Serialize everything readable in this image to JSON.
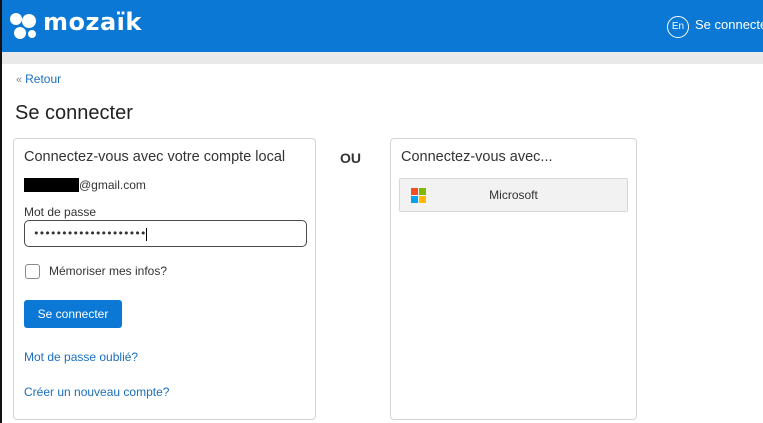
{
  "header": {
    "brand": "mozaïk",
    "language": "En",
    "login_link": "Se connecter"
  },
  "nav": {
    "back_label": "Retour"
  },
  "page": {
    "title": "Se connecter",
    "separator": "OU"
  },
  "local_login": {
    "title": "Connectez-vous avec votre compte local",
    "email_suffix": "@gmail.com",
    "password_label": "Mot de passe",
    "password_value": "••••••••••••••••••••",
    "remember_label": "Mémoriser mes infos?",
    "remember_checked": false,
    "submit_label": "Se connecter",
    "forgot_link": "Mot de passe oublié?",
    "create_link": "Créer un nouveau compte?"
  },
  "external_login": {
    "title": "Connectez-vous avec...",
    "microsoft_label": "Microsoft"
  },
  "colors": {
    "brand_blue": "#0a78d4",
    "link_blue": "#1a6fbf",
    "ms_red": "#f25022",
    "ms_green": "#7fba00",
    "ms_blue": "#00a4ef",
    "ms_yellow": "#ffb900"
  }
}
